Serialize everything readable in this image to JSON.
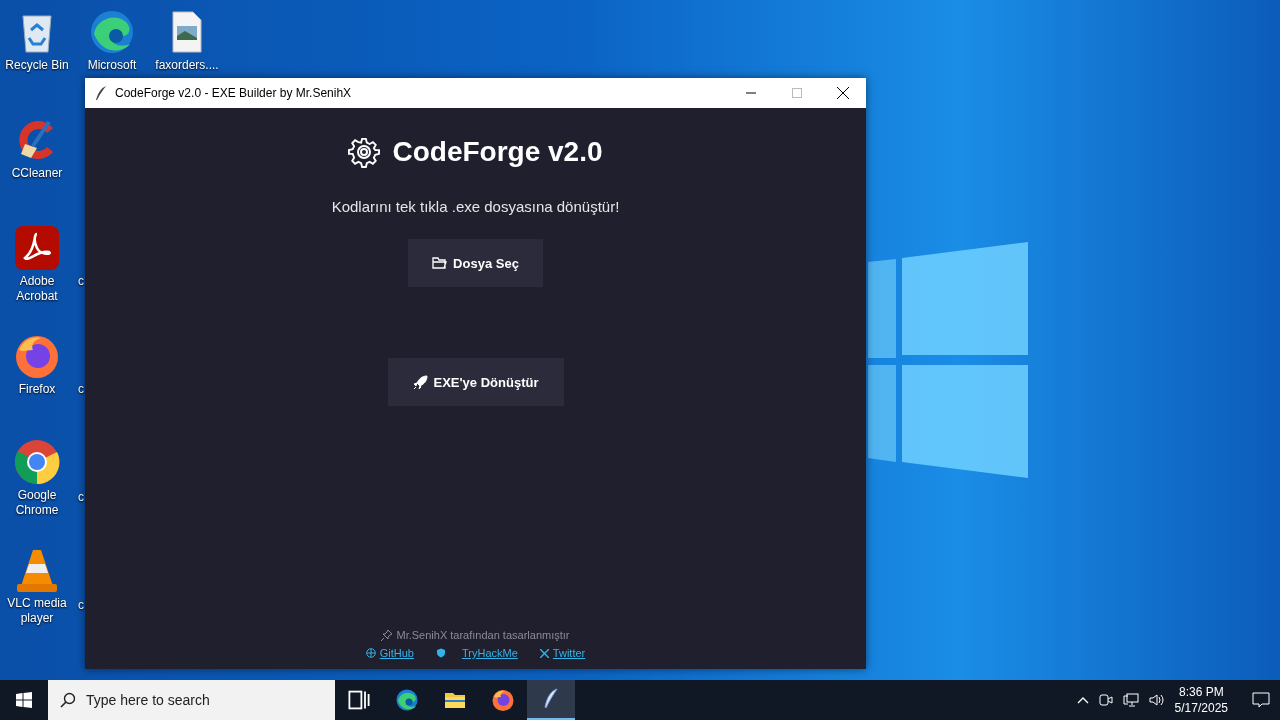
{
  "desktop": {
    "icons": [
      {
        "label": "Recycle Bin",
        "kind": "recycle"
      },
      {
        "label": "Microsoft",
        "kind": "edge"
      },
      {
        "label": "faxorders....",
        "kind": "image-file"
      },
      {
        "label": "CCleaner",
        "kind": "ccleaner"
      },
      {
        "label": "Adobe Acrobat",
        "kind": "acrobat"
      },
      {
        "label": "Firefox",
        "kind": "firefox"
      },
      {
        "label": "Google Chrome",
        "kind": "chrome"
      },
      {
        "label": "VLC media player",
        "kind": "vlc"
      }
    ],
    "partial_labels": [
      "c",
      "c",
      "c",
      "c"
    ]
  },
  "window": {
    "title": "CodeForge v2.0 - EXE Builder by Mr.SenihX",
    "heading": "CodeForge v2.0",
    "subtitle": "Kodlarını tek tıkla .exe dosyasına dönüştür!",
    "buttons": [
      {
        "label": "Dosya Seç",
        "kind": "folder"
      },
      {
        "label": "EXE'ye Dönüştür",
        "kind": "rocket"
      }
    ],
    "credit": "Mr.SenihX tarafından tasarlanmıştır",
    "links": [
      {
        "label": "GitHub",
        "kind": "globe"
      },
      {
        "label": "TryHackMe",
        "kind": "shield"
      },
      {
        "label": "Twitter",
        "kind": "x"
      }
    ]
  },
  "taskbar": {
    "search": {
      "placeholder": "Type here to search"
    },
    "apps": [
      {
        "kind": "taskview",
        "selected": false
      },
      {
        "kind": "edge",
        "selected": false
      },
      {
        "kind": "explorer",
        "selected": false
      },
      {
        "kind": "firefox",
        "selected": false
      },
      {
        "kind": "feather",
        "selected": true
      }
    ],
    "clock": {
      "time": "8:36 PM",
      "date": "5/17/2025"
    }
  }
}
